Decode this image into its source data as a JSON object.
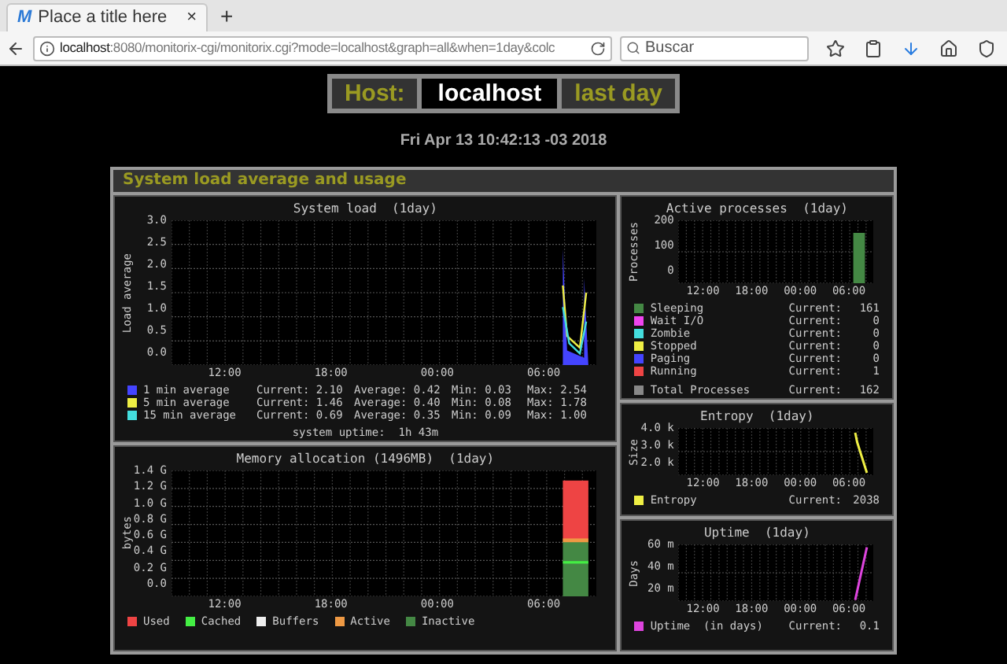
{
  "browser": {
    "tab_logo": "M",
    "tab_title": "Place a title here",
    "tab_close": "×",
    "new_tab": "+",
    "url_host": "localhost",
    "url_rest": ":8080/monitorix-cgi/monitorix.cgi?mode=localhost&graph=all&when=1day&colc",
    "search_placeholder": "Buscar"
  },
  "header": {
    "host_label": "Host:",
    "host": "localhost",
    "period": "last day",
    "date": "Fri Apr 13 10:42:13 -03 2018"
  },
  "section": {
    "title": "System load average and usage"
  },
  "left_graphs": [
    {
      "kind": "load",
      "title": "System load  (1day)",
      "ylabel": "Load average",
      "yticks": [
        "3.0",
        "2.5",
        "2.0",
        "1.5",
        "1.0",
        "0.5",
        "0.0"
      ],
      "xticks": [
        "12:00",
        "18:00",
        "00:00",
        "06:00"
      ],
      "legend": [
        {
          "color": "#4444ff",
          "cells": [
            "1 min average",
            "Current: 2.10",
            "Average: 0.42",
            "Min: 0.03",
            "Max: 2.54"
          ]
        },
        {
          "color": "#eeee44",
          "cells": [
            "5 min average",
            "Current: 1.46",
            "Average: 0.40",
            "Min: 0.08",
            "Max: 1.78"
          ]
        },
        {
          "color": "#44dddd",
          "cells": [
            "15 min average",
            "Current: 0.69",
            "Average: 0.35",
            "Min: 0.09",
            "Max: 1.00"
          ]
        }
      ],
      "footer": "system uptime:  1h 43m"
    },
    {
      "kind": "memory",
      "title": "Memory allocation (1496MB)  (1day)",
      "ylabel": "bytes",
      "yticks": [
        "1.4 G",
        "1.2 G",
        "1.0 G",
        "0.8 G",
        "0.6 G",
        "0.4 G",
        "0.2 G",
        "0.0"
      ],
      "xticks": [
        "12:00",
        "18:00",
        "00:00",
        "06:00"
      ],
      "legend": [
        {
          "color": "#ee4444",
          "cells": [
            "Used"
          ]
        },
        {
          "color": "#44ee44",
          "cells": [
            "Cached"
          ]
        },
        {
          "color": "#eeeeee",
          "cells": [
            "Buffers"
          ]
        },
        {
          "color": "#ee9944",
          "cells": [
            "Active"
          ]
        },
        {
          "color": "#448844",
          "cells": [
            "Inactive"
          ]
        }
      ]
    }
  ],
  "right_graphs": [
    {
      "kind": "processes",
      "title": "Active processes  (1day)",
      "ylabel": "Processes",
      "yticks": [
        "200",
        "100",
        "0"
      ],
      "xticks": [
        "12:00",
        "18:00",
        "00:00",
        "06:00"
      ],
      "legend": [
        {
          "color": "#448844",
          "cells": [
            "Sleeping",
            "Current:",
            "161"
          ]
        },
        {
          "color": "#ee44ee",
          "cells": [
            "Wait I/O",
            "Current:",
            "0"
          ]
        },
        {
          "color": "#44dddd",
          "cells": [
            "Zombie",
            "Current:",
            "0"
          ]
        },
        {
          "color": "#eeee44",
          "cells": [
            "Stopped",
            "Current:",
            "0"
          ]
        },
        {
          "color": "#4444ff",
          "cells": [
            "Paging",
            "Current:",
            "0"
          ]
        },
        {
          "color": "#ee4444",
          "cells": [
            "Running",
            "Current:",
            "1"
          ]
        }
      ],
      "total": {
        "color": "#888888",
        "cells": [
          "Total Processes",
          "Current:",
          "162"
        ]
      }
    },
    {
      "kind": "entropy",
      "title": "Entropy  (1day)",
      "ylabel": "Size",
      "yticks": [
        "4.0 k",
        "3.0 k",
        "2.0 k"
      ],
      "xticks": [
        "12:00",
        "18:00",
        "00:00",
        "06:00"
      ],
      "legend": [
        {
          "color": "#eeee44",
          "cells": [
            "Entropy",
            "Current:",
            "2038"
          ]
        }
      ]
    },
    {
      "kind": "uptime",
      "title": "Uptime  (1day)",
      "ylabel": "Days",
      "yticks": [
        "60 m",
        "40 m",
        "20 m"
      ],
      "xticks": [
        "12:00",
        "18:00",
        "00:00",
        "06:00"
      ],
      "legend": [
        {
          "color": "#dd44dd",
          "cells": [
            "Uptime  (in days)",
            "Current:",
            "0.1"
          ]
        }
      ]
    }
  ]
}
